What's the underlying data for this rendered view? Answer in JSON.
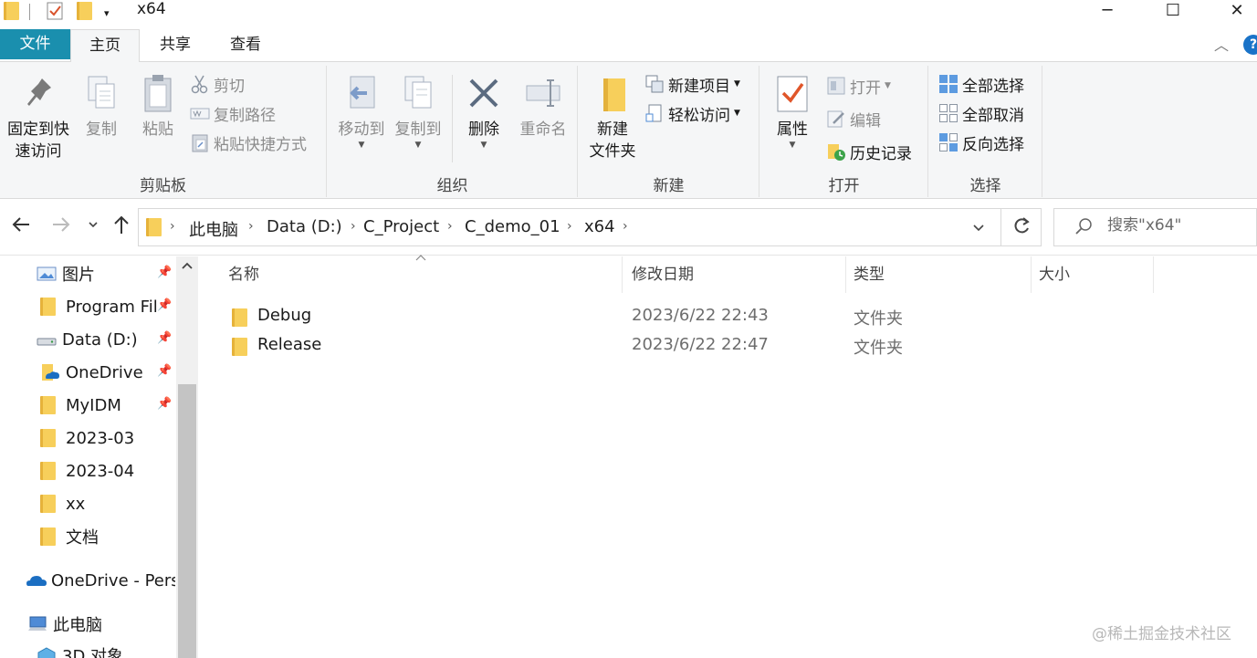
{
  "titlebar": {
    "title": "x64",
    "qa_dropdown": "▾",
    "minimize": "─",
    "maximize": "☐",
    "close": "✕"
  },
  "tabs": {
    "file": "文件",
    "home": "主页",
    "share": "共享",
    "view": "查看",
    "collapse": "︿",
    "help": "?"
  },
  "ribbon": {
    "clipboard": {
      "label": "剪贴板",
      "pin_line1": "固定到快",
      "pin_line2": "速访问",
      "copy": "复制",
      "paste": "粘贴",
      "cut": "剪切",
      "copy_path": "复制路径",
      "paste_shortcut": "粘贴快捷方式"
    },
    "organize": {
      "label": "组织",
      "move_to": "移动到",
      "copy_to": "复制到",
      "delete": "删除",
      "rename": "重命名"
    },
    "new": {
      "label": "新建",
      "new_folder_line1": "新建",
      "new_folder_line2": "文件夹",
      "new_item": "新建项目",
      "easy_access": "轻松访问"
    },
    "open": {
      "label": "打开",
      "properties": "属性",
      "open": "打开",
      "edit": "编辑",
      "history": "历史记录"
    },
    "select": {
      "label": "选择",
      "select_all": "全部选择",
      "select_none": "全部取消",
      "invert": "反向选择"
    }
  },
  "address": {
    "crumbs": [
      "此电脑",
      "Data (D:)",
      "C_Project",
      "C_demo_01",
      "x64"
    ],
    "sep": "›"
  },
  "search": {
    "placeholder": "搜索\"x64\""
  },
  "navpane": {
    "items": [
      {
        "label": "图片",
        "pinned": true
      },
      {
        "label": "Program Fil",
        "pinned": true
      },
      {
        "label": "Data (D:)",
        "pinned": true
      },
      {
        "label": "OneDrive",
        "pinned": true
      },
      {
        "label": "MyIDM",
        "pinned": true
      },
      {
        "label": "2023-03",
        "pinned": false
      },
      {
        "label": "2023-04",
        "pinned": false
      },
      {
        "label": "xx",
        "pinned": false
      },
      {
        "label": "文档",
        "pinned": false
      },
      {
        "label": "OneDrive - Pers",
        "pinned": false
      },
      {
        "label": "此电脑",
        "pinned": false
      },
      {
        "label": "3D 对象",
        "pinned": false
      }
    ],
    "pin_glyph": "📌"
  },
  "filelist": {
    "columns": {
      "name": "名称",
      "date": "修改日期",
      "type": "类型",
      "size": "大小"
    },
    "rows": [
      {
        "name": "Debug",
        "date": "2023/6/22 22:43",
        "type": "文件夹"
      },
      {
        "name": "Release",
        "date": "2023/6/22 22:47",
        "type": "文件夹"
      }
    ]
  },
  "watermark": "@稀土掘金技术社区",
  "colors": {
    "file_tab": "#1a8fae",
    "folder": "#f7cf5b",
    "ribbon_bg": "#f5f6f7"
  }
}
